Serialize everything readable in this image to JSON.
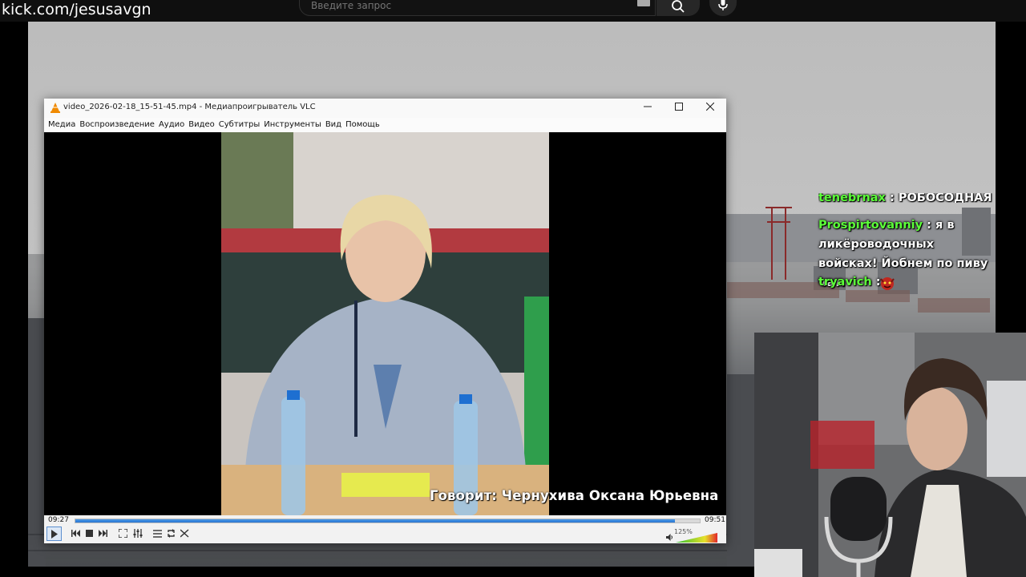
{
  "browser": {
    "channel_url": "kick.com/jesusavgn",
    "search_placeholder": "Введите запрос"
  },
  "vlc": {
    "window_title": "video_2026-02-18_15-51-45.mp4 - Медиапроигрыватель VLC",
    "menu": [
      "Медиа",
      "Воспроизведение",
      "Аудио",
      "Видео",
      "Субтитры",
      "Инструменты",
      "Вид",
      "Помощь"
    ],
    "subtitle_caption": "Говорит: Чернухива Оксана Юрьевна",
    "time_elapsed": "09:27",
    "time_total": "09:51",
    "progress_fraction": 0.96,
    "volume_label": "125%",
    "volume_fraction": 1.0,
    "accent_color": "#2a76d2"
  },
  "chat": {
    "messages": [
      {
        "user": "tenebrnax",
        "text": "РОБОСОДНАЯ",
        "cut_off": true
      },
      {
        "user": "Prospirtovanniy",
        "text": "я в ликёроводочных войсках! Йобнем по пиву чат."
      },
      {
        "user": "tryavich",
        "text": "",
        "emote": "red-demon-emote"
      }
    ],
    "username_color": "#5cff3a"
  },
  "icons": [
    "search-icon",
    "mic-icon",
    "keyboard-icon",
    "vlc-cone-icon",
    "minimize-icon",
    "maximize-icon",
    "close-icon",
    "play-icon",
    "prev-icon",
    "stop-icon",
    "next-icon",
    "fullscreen-icon",
    "equalizer-icon",
    "playlist-icon",
    "loop-icon",
    "shuffle-icon",
    "volume-icon"
  ]
}
